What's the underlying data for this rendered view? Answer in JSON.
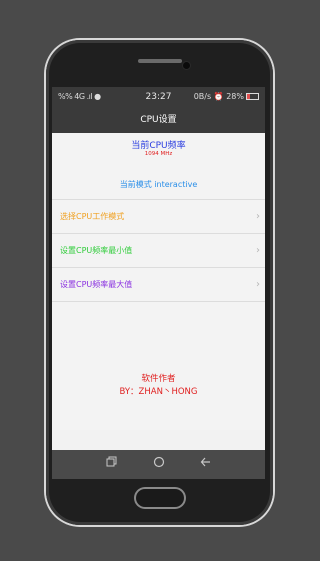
{
  "status_bar": {
    "signal": "%% 4G .ıl ●",
    "time": "23:27",
    "battery": "28%",
    "speed": "0B/s"
  },
  "action_bar": {
    "title": "CPU设置"
  },
  "current_freq": {
    "label": "当前CPU频率",
    "value": "1094 MHz"
  },
  "current_mode": {
    "label": "当前模式 interactive"
  },
  "menu": [
    {
      "label": "选择CPU工作模式",
      "color": "#f0a020"
    },
    {
      "label": "设置CPU频率最小值",
      "color": "#2fcc3a"
    },
    {
      "label": "设置CPU频率最大值",
      "color": "#8a30e0"
    }
  ],
  "author": {
    "title": "软件作者",
    "name": "BY：ZHAN丶HONG"
  },
  "icons": {
    "arrow": "chevron-right-icon",
    "recent": "recent-apps-icon",
    "home": "home-icon",
    "back": "back-icon"
  }
}
